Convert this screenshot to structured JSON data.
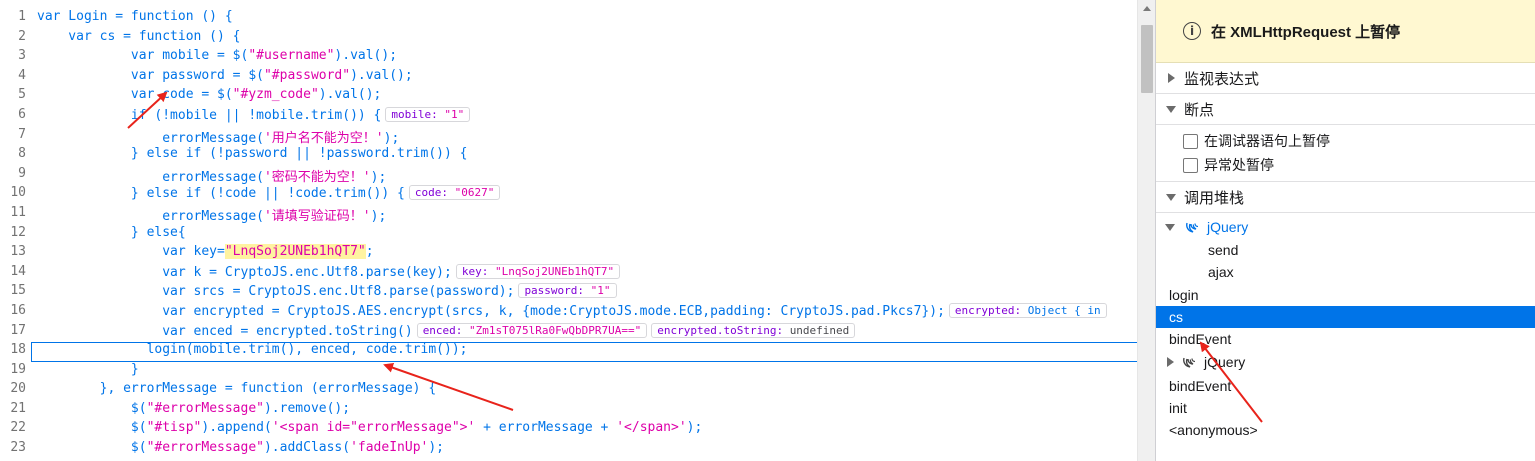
{
  "editor": {
    "lines": [
      [
        {
          "t": "var Login = function () {"
        }
      ],
      [
        {
          "t": "    var cs = function () {"
        }
      ],
      [
        {
          "t": "            var mobile = $("
        },
        {
          "t": "\"#username\"",
          "c": "str"
        },
        {
          "t": ").val();"
        }
      ],
      [
        {
          "t": "            var password = $("
        },
        {
          "t": "\"#password\"",
          "c": "str"
        },
        {
          "t": ").val();"
        }
      ],
      [
        {
          "t": "            var code = $("
        },
        {
          "t": "\"#yzm_code\"",
          "c": "str"
        },
        {
          "t": ").val();"
        }
      ],
      [
        {
          "t": "            if (!mobile || !mobile.trim()) {"
        },
        {
          "chip": [
            "mobile:",
            "\"1\""
          ]
        }
      ],
      [
        {
          "t": "                errorMessage("
        },
        {
          "t": "'用户名不能为空！'",
          "c": "str"
        },
        {
          "t": ");"
        }
      ],
      [
        {
          "t": "            } else if (!password || !password.trim()) {"
        }
      ],
      [
        {
          "t": "                errorMessage("
        },
        {
          "t": "'密码不能为空！'",
          "c": "str"
        },
        {
          "t": ");"
        }
      ],
      [
        {
          "t": "            } else if (!code || !code.trim()) {"
        },
        {
          "chip": [
            "code:",
            "\"0627\""
          ]
        }
      ],
      [
        {
          "t": "                errorMessage("
        },
        {
          "t": "'请填写验证码！'",
          "c": "str"
        },
        {
          "t": ");"
        }
      ],
      [
        {
          "t": "            } else{"
        }
      ],
      [
        {
          "t": "                var key="
        },
        {
          "t": "\"LnqSoj2UNEb1hQT7\"",
          "c": "hl"
        },
        {
          "t": ";"
        }
      ],
      [
        {
          "t": "                var k = CryptoJS.enc.Utf8.parse(key);"
        },
        {
          "chip": [
            "key:",
            "\"LnqSoj2UNEb1hQT7\""
          ]
        }
      ],
      [
        {
          "t": "                var srcs = CryptoJS.enc.Utf8.parse(password);"
        },
        {
          "chip": [
            "password:",
            "\"1\""
          ]
        }
      ],
      [
        {
          "t": "                var encrypted = CryptoJS.AES.encrypt(srcs, k, {mode:CryptoJS.mode.ECB,padding: CryptoJS.pad.Pkcs7});"
        },
        {
          "chip": [
            "encrypted:",
            "Object { in",
            "blue"
          ]
        }
      ],
      [
        {
          "t": "                var enced = encrypted.toString()"
        },
        {
          "chip": [
            "enced:",
            "\"Zm1sT075lRa0FwQbDPR7UA==\""
          ]
        },
        {
          "chip": [
            "encrypted.toString:",
            "undefined",
            "grey"
          ]
        }
      ],
      [
        {
          "t": "              login(mobile.trim(), enced, code.trim());"
        }
      ],
      [
        {
          "t": "            }"
        }
      ],
      [
        {
          "t": "        }, errorMessage = function (errorMessage) {"
        }
      ],
      [
        {
          "t": "            $("
        },
        {
          "t": "\"#errorMessage\"",
          "c": "str"
        },
        {
          "t": ").remove();"
        }
      ],
      [
        {
          "t": "            $("
        },
        {
          "t": "\"#tisp\"",
          "c": "str"
        },
        {
          "t": ").append("
        },
        {
          "t": "'<span id=\"errorMessage\">'",
          "c": "str"
        },
        {
          "t": " + errorMessage + "
        },
        {
          "t": "'</span>'",
          "c": "str"
        },
        {
          "t": ");"
        }
      ],
      [
        {
          "t": "            $("
        },
        {
          "t": "\"#errorMessage\"",
          "c": "str"
        },
        {
          "t": ").addClass("
        },
        {
          "t": "'fadeInUp'",
          "c": "str"
        },
        {
          "t": ");"
        }
      ]
    ],
    "current_line": 18
  },
  "panel": {
    "pause_title": "在 XMLHttpRequest 上暂停",
    "watch_label": "监视表达式",
    "breakpoints_label": "断点",
    "pause_on_debugger": "在调试器语句上暂停",
    "pause_on_exceptions": "异常处暂停",
    "callstack_label": "调用堆栈",
    "jquery_group": "jQuery",
    "jquery_frames": [
      "send",
      "ajax"
    ],
    "frames_a": [
      "login",
      "cs",
      "bindEvent"
    ],
    "jquery_group_2": "jQuery",
    "frames_b": [
      "bindEvent",
      "init",
      "<anonymous>"
    ]
  },
  "colors": {
    "accent": "#0074e8",
    "string": "#dd00a9",
    "annotation_arrow": "#e8231b",
    "pause_banner": "#fff8d1"
  }
}
